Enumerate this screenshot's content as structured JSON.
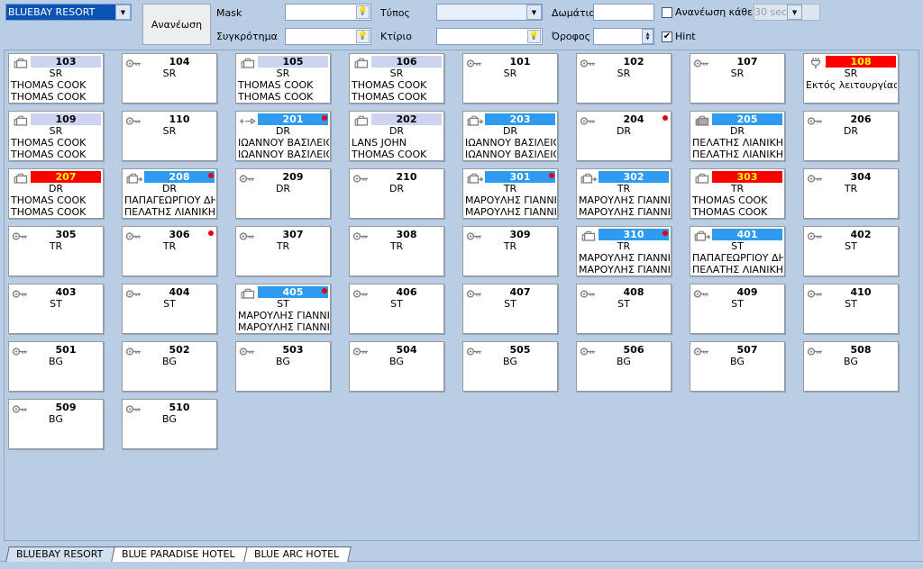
{
  "toolbar": {
    "hotel_selector": {
      "value": "BLUEBAY RESORT",
      "arrow": "chevron-down-icon"
    },
    "refresh_button": "Ανανέωση",
    "mask_label": "Mask",
    "mask_value": "",
    "complex_label": "Συγκρότημα",
    "complex_value": "",
    "type_label": "Τύπος",
    "type_value": "",
    "building_label": "Κτίριο",
    "building_value": "",
    "room_label": "Δωμάτιο",
    "room_value": "",
    "floor_label": "Όροφος",
    "floor_value": "",
    "autorefresh_label": "Ανανέωση κάθε",
    "autorefresh_checked": "",
    "autorefresh_interval": "30 sec",
    "hint_label": "Hint",
    "hint_checked": "✔",
    "bulb_icon": "💡"
  },
  "colors": {
    "band_lilac": "#ccd4f0",
    "band_blue": "#2e9bf0",
    "band_red": "#fc0000",
    "band_red_text": "#ffff00",
    "dot_red": "#e00000",
    "page_bg": "#b9cde5"
  },
  "rooms": [
    {
      "number": "103",
      "type": "SR",
      "band": "lilac",
      "icon": "suitcase-icon",
      "guest1": "THOMAS COOK",
      "guest2": "THOMAS COOK",
      "dot": false
    },
    {
      "number": "104",
      "type": "SR",
      "band": "none",
      "icon": "key-icon",
      "guest1": "",
      "guest2": "",
      "dot": false
    },
    {
      "number": "105",
      "type": "SR",
      "band": "lilac",
      "icon": "suitcase-icon",
      "guest1": "THOMAS COOK",
      "guest2": "THOMAS COOK",
      "dot": false
    },
    {
      "number": "106",
      "type": "SR",
      "band": "lilac",
      "icon": "suitcase-icon",
      "guest1": "THOMAS COOK",
      "guest2": "THOMAS COOK",
      "dot": false
    },
    {
      "number": "101",
      "type": "SR",
      "band": "none",
      "icon": "key-icon",
      "guest1": "",
      "guest2": "",
      "dot": false
    },
    {
      "number": "102",
      "type": "SR",
      "band": "none",
      "icon": "key-icon",
      "guest1": "",
      "guest2": "",
      "dot": false
    },
    {
      "number": "107",
      "type": "SR",
      "band": "none",
      "icon": "key-icon",
      "guest1": "",
      "guest2": "",
      "dot": false
    },
    {
      "number": "108",
      "type": "SR",
      "band": "red",
      "icon": "wrench-icon",
      "guest1": "Εκτός λειτουργίας",
      "guest2": "",
      "dot": false
    },
    {
      "number": "109",
      "type": "SR",
      "band": "lilac",
      "icon": "suitcase-icon",
      "guest1": "THOMAS COOK",
      "guest2": "THOMAS COOK",
      "dot": false
    },
    {
      "number": "110",
      "type": "SR",
      "band": "none",
      "icon": "key-icon",
      "guest1": "",
      "guest2": "",
      "dot": false
    },
    {
      "number": "201",
      "type": "DR",
      "band": "blue",
      "icon": "departure-icon",
      "guest1": "ΙΩΑΝΝΟΥ ΒΑΣΙΛΕΙΟΣ",
      "guest2": "ΙΩΑΝΝΟΥ ΒΑΣΙΛΕΙΟΣ",
      "dot": true
    },
    {
      "number": "202",
      "type": "DR",
      "band": "lilac",
      "icon": "suitcase-icon",
      "guest1": "LANS JOHN",
      "guest2": "THOMAS COOK",
      "dot": false
    },
    {
      "number": "203",
      "type": "DR",
      "band": "blue",
      "icon": "arrival-icon",
      "guest1": "ΙΩΑΝΝΟΥ ΒΑΣΙΛΕΙΟΣ",
      "guest2": "ΙΩΑΝΝΟΥ ΒΑΣΙΛΕΙΟΣ",
      "dot": false
    },
    {
      "number": "204",
      "type": "DR",
      "band": "none",
      "icon": "key-icon",
      "guest1": "",
      "guest2": "",
      "dot": true
    },
    {
      "number": "205",
      "type": "DR",
      "band": "blue",
      "icon": "suitcase-filled-icon",
      "guest1": "ΠΕΛΑΤΗΣ ΛΙΑΝΙΚΗΣ",
      "guest2": "ΠΕΛΑΤΗΣ ΛΙΑΝΙΚΗΣ",
      "dot": false
    },
    {
      "number": "206",
      "type": "DR",
      "band": "none",
      "icon": "key-icon",
      "guest1": "",
      "guest2": "",
      "dot": false
    },
    {
      "number": "207",
      "type": "DR",
      "band": "red",
      "icon": "suitcase-icon",
      "guest1": "THOMAS COOK",
      "guest2": "THOMAS COOK",
      "dot": false
    },
    {
      "number": "208",
      "type": "DR",
      "band": "blue",
      "icon": "arrival-icon",
      "guest1": "ΠΑΠΑΓΕΩΡΓΙΟΥ ΔΗΜ",
      "guest2": "ΠΕΛΑΤΗΣ ΛΙΑΝΙΚΗΣ",
      "dot": true
    },
    {
      "number": "209",
      "type": "DR",
      "band": "none",
      "icon": "key-icon",
      "guest1": "",
      "guest2": "",
      "dot": false
    },
    {
      "number": "210",
      "type": "DR",
      "band": "none",
      "icon": "key-icon",
      "guest1": "",
      "guest2": "",
      "dot": false
    },
    {
      "number": "301",
      "type": "TR",
      "band": "blue",
      "icon": "arrival-icon",
      "guest1": "ΜΑΡΟΥΛΗΣ ΓΙΑΝΝΗΣ",
      "guest2": "ΜΑΡΟΥΛΗΣ ΓΙΑΝΝΗΣ",
      "dot": true
    },
    {
      "number": "302",
      "type": "TR",
      "band": "blue",
      "icon": "arrival-icon",
      "guest1": "ΜΑΡΟΥΛΗΣ ΓΙΑΝΝΗΣ",
      "guest2": "ΜΑΡΟΥΛΗΣ ΓΙΑΝΝΗΣ",
      "dot": false
    },
    {
      "number": "303",
      "type": "TR",
      "band": "red",
      "icon": "suitcase-icon",
      "guest1": "THOMAS COOK",
      "guest2": "THOMAS COOK",
      "dot": false
    },
    {
      "number": "304",
      "type": "TR",
      "band": "none",
      "icon": "key-icon",
      "guest1": "",
      "guest2": "",
      "dot": false
    },
    {
      "number": "305",
      "type": "TR",
      "band": "none",
      "icon": "key-icon",
      "guest1": "",
      "guest2": "",
      "dot": false
    },
    {
      "number": "306",
      "type": "TR",
      "band": "none",
      "icon": "key-icon",
      "guest1": "",
      "guest2": "",
      "dot": true
    },
    {
      "number": "307",
      "type": "TR",
      "band": "none",
      "icon": "key-icon",
      "guest1": "",
      "guest2": "",
      "dot": false
    },
    {
      "number": "308",
      "type": "TR",
      "band": "none",
      "icon": "key-icon",
      "guest1": "",
      "guest2": "",
      "dot": false
    },
    {
      "number": "309",
      "type": "TR",
      "band": "none",
      "icon": "key-icon",
      "guest1": "",
      "guest2": "",
      "dot": false
    },
    {
      "number": "310",
      "type": "TR",
      "band": "blue",
      "icon": "suitcase-icon",
      "guest1": "ΜΑΡΟΥΛΗΣ ΓΙΑΝΝΗΣ",
      "guest2": "ΜΑΡΟΥΛΗΣ ΓΙΑΝΝΗΣ",
      "dot": true
    },
    {
      "number": "401",
      "type": "ST",
      "band": "blue",
      "icon": "arrival-icon",
      "guest1": "ΠΑΠΑΓΕΩΡΓΙΟΥ ΔΗΜ",
      "guest2": "ΠΕΛΑΤΗΣ ΛΙΑΝΙΚΗΣ",
      "dot": false
    },
    {
      "number": "402",
      "type": "ST",
      "band": "none",
      "icon": "key-icon",
      "guest1": "",
      "guest2": "",
      "dot": false
    },
    {
      "number": "403",
      "type": "ST",
      "band": "none",
      "icon": "key-icon",
      "guest1": "",
      "guest2": "",
      "dot": false
    },
    {
      "number": "404",
      "type": "ST",
      "band": "none",
      "icon": "key-icon",
      "guest1": "",
      "guest2": "",
      "dot": false
    },
    {
      "number": "405",
      "type": "ST",
      "band": "blue",
      "icon": "suitcase-icon",
      "guest1": "ΜΑΡΟΥΛΗΣ ΓΙΑΝΝΗΣ",
      "guest2": "ΜΑΡΟΥΛΗΣ ΓΙΑΝΝΗΣ",
      "dot": true
    },
    {
      "number": "406",
      "type": "ST",
      "band": "none",
      "icon": "key-icon",
      "guest1": "",
      "guest2": "",
      "dot": false
    },
    {
      "number": "407",
      "type": "ST",
      "band": "none",
      "icon": "key-icon",
      "guest1": "",
      "guest2": "",
      "dot": false
    },
    {
      "number": "408",
      "type": "ST",
      "band": "none",
      "icon": "key-icon",
      "guest1": "",
      "guest2": "",
      "dot": false
    },
    {
      "number": "409",
      "type": "ST",
      "band": "none",
      "icon": "key-icon",
      "guest1": "",
      "guest2": "",
      "dot": false
    },
    {
      "number": "410",
      "type": "ST",
      "band": "none",
      "icon": "key-icon",
      "guest1": "",
      "guest2": "",
      "dot": false
    },
    {
      "number": "501",
      "type": "BG",
      "band": "none",
      "icon": "key-icon",
      "guest1": "",
      "guest2": "",
      "dot": false
    },
    {
      "number": "502",
      "type": "BG",
      "band": "none",
      "icon": "key-icon",
      "guest1": "",
      "guest2": "",
      "dot": false
    },
    {
      "number": "503",
      "type": "BG",
      "band": "none",
      "icon": "key-icon",
      "guest1": "",
      "guest2": "",
      "dot": false
    },
    {
      "number": "504",
      "type": "BG",
      "band": "none",
      "icon": "key-icon",
      "guest1": "",
      "guest2": "",
      "dot": false
    },
    {
      "number": "505",
      "type": "BG",
      "band": "none",
      "icon": "key-icon",
      "guest1": "",
      "guest2": "",
      "dot": false
    },
    {
      "number": "506",
      "type": "BG",
      "band": "none",
      "icon": "key-icon",
      "guest1": "",
      "guest2": "",
      "dot": false
    },
    {
      "number": "507",
      "type": "BG",
      "band": "none",
      "icon": "key-icon",
      "guest1": "",
      "guest2": "",
      "dot": false
    },
    {
      "number": "508",
      "type": "BG",
      "band": "none",
      "icon": "key-icon",
      "guest1": "",
      "guest2": "",
      "dot": false
    },
    {
      "number": "509",
      "type": "BG",
      "band": "none",
      "icon": "key-icon",
      "guest1": "",
      "guest2": "",
      "dot": false
    },
    {
      "number": "510",
      "type": "BG",
      "band": "none",
      "icon": "key-icon",
      "guest1": "",
      "guest2": "",
      "dot": false
    }
  ],
  "tabs": [
    {
      "label": "BLUEBAY RESORT",
      "active": true
    },
    {
      "label": "BLUE PARADISE HOTEL",
      "active": false
    },
    {
      "label": "BLUE ARC HOTEL",
      "active": false
    }
  ]
}
